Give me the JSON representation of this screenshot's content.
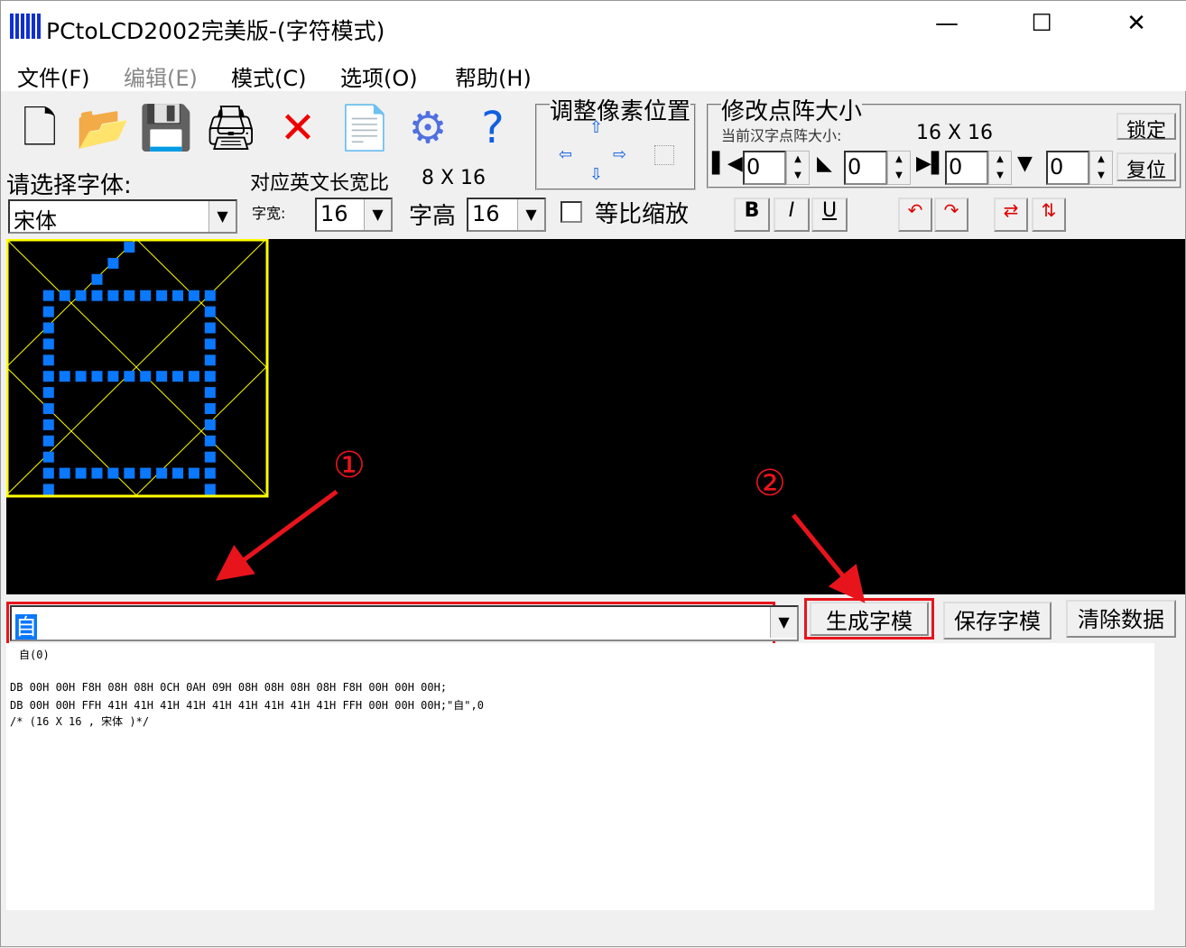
{
  "window": {
    "title": "PCtoLCD2002完美版-(字符模式)",
    "minimize": "—",
    "maximize": "☐",
    "close": "✕"
  },
  "menu": [
    {
      "label": "文件(F)"
    },
    {
      "label": "编辑(E)",
      "disabled": true
    },
    {
      "label": "模式(C)"
    },
    {
      "label": "选项(O)"
    },
    {
      "label": "帮助(H)"
    }
  ],
  "toolbar": {
    "icons": [
      "new-icon",
      "open-icon",
      "save-icon",
      "export-icon",
      "delete-icon",
      "notepad-icon",
      "settings-gear-icon",
      "help-icon"
    ]
  },
  "font": {
    "label": "请选择字体:",
    "value": "宋体",
    "ratio_label": "对应英文长宽比",
    "ratio_value": "8 X 16",
    "width_label": "字宽:",
    "width_value": "16",
    "height_label": "字高",
    "height_value": "16",
    "proportional_label": "等比缩放",
    "proportional_checked": false
  },
  "pixel_adjust": {
    "title": "调整像素位置"
  },
  "matrix": {
    "title": "修改点阵大小",
    "current_label": "当前汉字点阵大小:",
    "current_value": "16 X 16",
    "lock": "锁定",
    "reset": "复位",
    "left": "0",
    "top": "0",
    "right": "0",
    "bottom": "0"
  },
  "style_buttons": {
    "bold": "B",
    "italic": "I",
    "underline": "U"
  },
  "preview": {
    "pixel_color": "#0a78ff",
    "grid_color": "#ffff00",
    "bytes": [
      "00",
      "00",
      "F8",
      "08",
      "08",
      "0C",
      "0A",
      "09",
      "08",
      "08",
      "08",
      "08",
      "F8",
      "00",
      "00",
      "00",
      "00",
      "00",
      "FF",
      "41",
      "41",
      "41",
      "41",
      "41",
      "41",
      "41",
      "41",
      "41",
      "FF",
      "00",
      "00",
      "00"
    ]
  },
  "input": {
    "value": "自"
  },
  "buttons": {
    "generate": "生成字模",
    "save": "保存字模",
    "clear": "清除数据"
  },
  "output": {
    "lines": [
      "自(0)",
      "",
      "DB 00H 00H F8H 08H 08H 0CH 0AH 09H 08H 08H 08H 08H F8H 00H 00H 00H;",
      "DB 00H 00H FFH 41H 41H 41H 41H 41H 41H 41H 41H 41H FFH 00H 00H 00H;\"自\",0",
      "/* (16 X 16 , 宋体 )*/"
    ]
  },
  "annotations": {
    "one": "①",
    "two": "②",
    "color": "#e8141c"
  }
}
